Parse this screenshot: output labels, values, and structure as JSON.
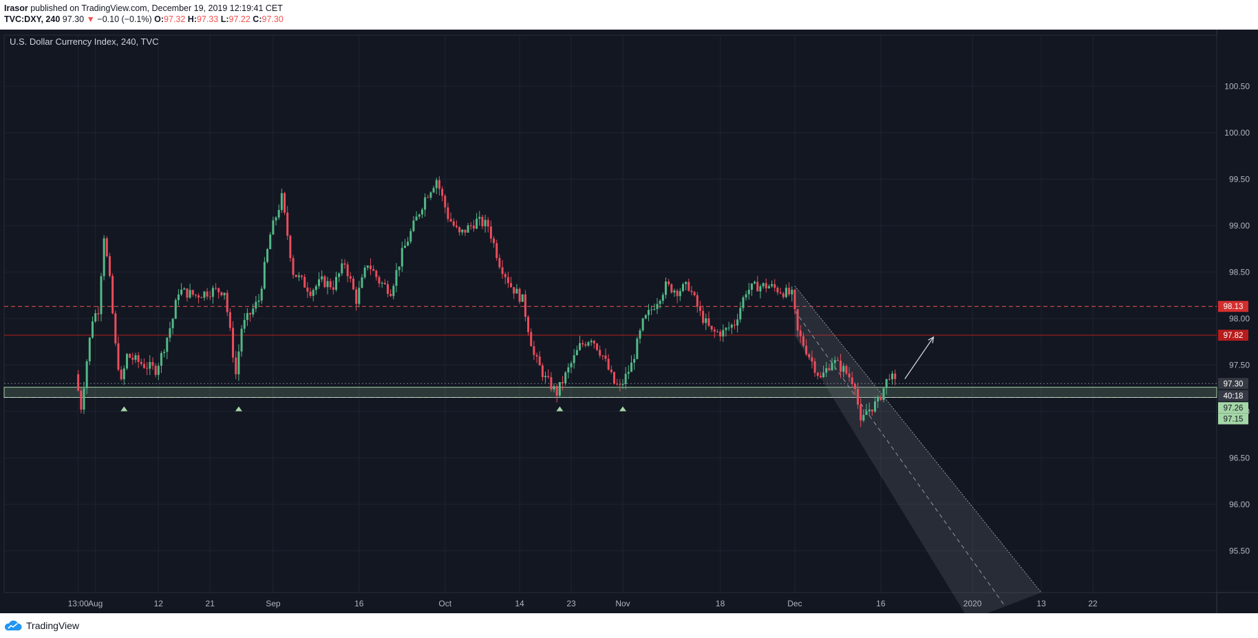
{
  "header": {
    "author": "Irasor",
    "published_text": "published on TradingView.com, December 19, 2019 12:19:41 CET",
    "symbol": "TVC:DXY, 240",
    "last": "97.30",
    "change": "−0.10 (−0.1%)",
    "o_label": "O:",
    "o": "97.32",
    "h_label": "H:",
    "h": "97.33",
    "l_label": "L:",
    "l": "97.22",
    "c_label": "C:",
    "c": "97.30"
  },
  "footer": {
    "brand": "TradingView"
  },
  "colors": {
    "background": "#131722",
    "up": "#53b987",
    "down": "#eb4d5c",
    "grid": "#1f2432",
    "axis_text": "#b2b5be",
    "resistance": "#f23645",
    "support": "#a5d6a7"
  },
  "chart_data": {
    "type": "candlestick",
    "title": "U.S. Dollar Currency Index, 240, TVC",
    "ylim": [
      95.05,
      101.05
    ],
    "y_ticks": [
      "100.50",
      "100.00",
      "99.50",
      "99.00",
      "98.50",
      "98.00",
      "97.50",
      "97.00",
      "96.50",
      "96.00",
      "95.50"
    ],
    "x_ticks": [
      "13:00",
      "Aug",
      "12",
      "21",
      "Sep",
      "16",
      "Oct",
      "14",
      "23",
      "Nov",
      "18",
      "Dec",
      "16",
      "2020",
      "13",
      "22"
    ],
    "price_labels": [
      {
        "text": "98.13",
        "value": 98.13,
        "color": "#d32f2f"
      },
      {
        "text": "97.82",
        "value": 97.82,
        "color": "#b71c1c"
      },
      {
        "text": "97.30",
        "value": 97.3,
        "color": "#363a45"
      },
      {
        "text": "40:18",
        "value": 97.17,
        "color": "#363a45"
      },
      {
        "text": "97.26",
        "value": 97.04,
        "color": "#a5d6a7"
      },
      {
        "text": "97.15",
        "value": 96.92,
        "color": "#a5d6a7"
      }
    ],
    "horizontal_lines": [
      {
        "value": 98.13,
        "style": "dashed",
        "color": "#ef5350"
      },
      {
        "value": 97.82,
        "style": "solid",
        "color": "#b71c1c"
      },
      {
        "value": 97.3,
        "style": "dotted",
        "color": "#787b86"
      }
    ],
    "support_zone": [
      97.15,
      97.26
    ],
    "support_markers_date": [
      "Aug 6",
      "Aug 26",
      "Oct 21",
      "Nov 1"
    ],
    "close_path": [
      [
        "Jul 29",
        97.4
      ],
      [
        "Jul 30",
        97.05
      ],
      [
        "Jul 31",
        97.55
      ],
      [
        "Aug 1",
        98.0
      ],
      [
        "Aug 2",
        98.1
      ],
      [
        "Aug 3",
        98.9
      ],
      [
        "Aug 4",
        98.4
      ],
      [
        "Aug 5",
        97.7
      ],
      [
        "Aug 6",
        97.3
      ],
      [
        "Aug 7",
        97.6
      ],
      [
        "Aug 10",
        97.5
      ],
      [
        "Aug 12",
        97.45
      ],
      [
        "Aug 13",
        97.6
      ],
      [
        "Aug 15",
        98.0
      ],
      [
        "Aug 16",
        98.3
      ],
      [
        "Aug 19",
        98.25
      ],
      [
        "Aug 22",
        98.3
      ],
      [
        "Aug 24",
        98.3
      ],
      [
        "Aug 26",
        97.4
      ],
      [
        "Aug 27",
        97.9
      ],
      [
        "Aug 30",
        98.2
      ],
      [
        "Sep 1",
        98.9
      ],
      [
        "Sep 3",
        99.3
      ],
      [
        "Sep 5",
        98.5
      ],
      [
        "Sep 8",
        98.3
      ],
      [
        "Sep 10",
        98.4
      ],
      [
        "Sep 12",
        98.35
      ],
      [
        "Sep 14",
        98.6
      ],
      [
        "Sep 16",
        98.2
      ],
      [
        "Sep 18",
        98.6
      ],
      [
        "Sep 20",
        98.4
      ],
      [
        "Sep 22",
        98.3
      ],
      [
        "Sep 24",
        98.7
      ],
      [
        "Sep 26",
        99.0
      ],
      [
        "Sep 28",
        99.3
      ],
      [
        "Sep 30",
        99.5
      ],
      [
        "Oct 2",
        99.1
      ],
      [
        "Oct 4",
        98.9
      ],
      [
        "Oct 7",
        99.05
      ],
      [
        "Oct 9",
        99.0
      ],
      [
        "Oct 11",
        98.6
      ],
      [
        "Oct 13",
        98.35
      ],
      [
        "Oct 15",
        98.2
      ],
      [
        "Oct 17",
        97.6
      ],
      [
        "Oct 19",
        97.35
      ],
      [
        "Oct 21",
        97.2
      ],
      [
        "Oct 23",
        97.45
      ],
      [
        "Oct 25",
        97.7
      ],
      [
        "Oct 27",
        97.8
      ],
      [
        "Oct 29",
        97.6
      ],
      [
        "Oct 31",
        97.3
      ],
      [
        "Nov 1",
        97.25
      ],
      [
        "Nov 3",
        97.5
      ],
      [
        "Nov 5",
        97.95
      ],
      [
        "Nov 7",
        98.15
      ],
      [
        "Nov 9",
        98.35
      ],
      [
        "Nov 11",
        98.3
      ],
      [
        "Nov 13",
        98.35
      ],
      [
        "Nov 15",
        98.05
      ],
      [
        "Nov 17",
        97.85
      ],
      [
        "Nov 19",
        97.85
      ],
      [
        "Nov 21",
        97.95
      ],
      [
        "Nov 23",
        98.3
      ],
      [
        "Nov 25",
        98.35
      ],
      [
        "Nov 27",
        98.35
      ],
      [
        "Nov 29",
        98.3
      ],
      [
        "Dec 1",
        98.25
      ],
      [
        "Dec 2",
        97.85
      ],
      [
        "Dec 4",
        97.6
      ],
      [
        "Dec 6",
        97.35
      ],
      [
        "Dec 8",
        97.55
      ],
      [
        "Dec 10",
        97.45
      ],
      [
        "Dec 12",
        97.3
      ],
      [
        "Dec 13",
        96.85
      ],
      [
        "Dec 14",
        97.0
      ],
      [
        "Dec 16",
        97.1
      ],
      [
        "Dec 17",
        97.25
      ],
      [
        "Dec 18",
        97.4
      ],
      [
        "Dec 19",
        97.3
      ]
    ],
    "channel": {
      "from": [
        "Dec 1",
        98.35
      ],
      "to": [
        "Jan 13",
        95.05
      ]
    },
    "forecast_arrow": {
      "from": [
        "Dec 19",
        97.35
      ],
      "to": [
        "Dec 24",
        97.8
      ]
    }
  }
}
